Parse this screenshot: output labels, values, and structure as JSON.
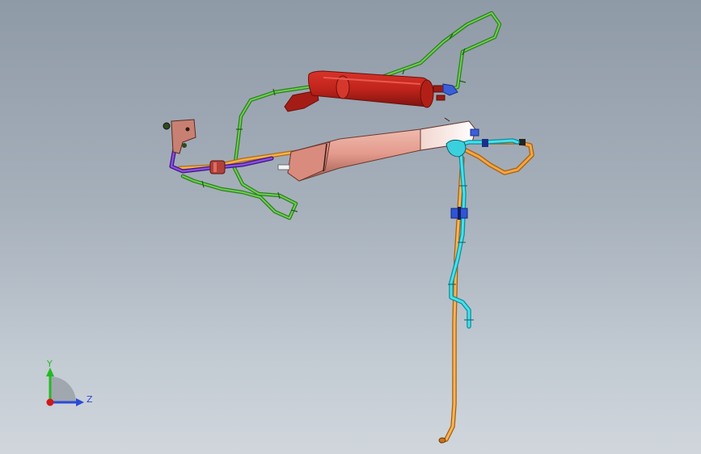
{
  "viewport": {
    "background_top": "#8f9aa7",
    "background_bottom": "#d0d6dc"
  },
  "colors": {
    "canister_red": "#c0241c",
    "canister_dark": "#8a1510",
    "tube_green": "#3e9a2a",
    "tube_orange": "#f2a13a",
    "tube_cyan": "#33d6e6",
    "tube_purple": "#6a2bb8",
    "connector_blue": "#3a5fd8",
    "duct_pink": "#e8a59a",
    "duct_white": "#f6f2f0",
    "bracket_brown": "#b06a5c",
    "axis_y": "#22bb22",
    "axis_z": "#2a4ad8",
    "axis_origin": "#d01818"
  },
  "triad": {
    "y_label": "Y",
    "z_label": "Z"
  },
  "icons": [
    "coordinate-triad-icon"
  ]
}
